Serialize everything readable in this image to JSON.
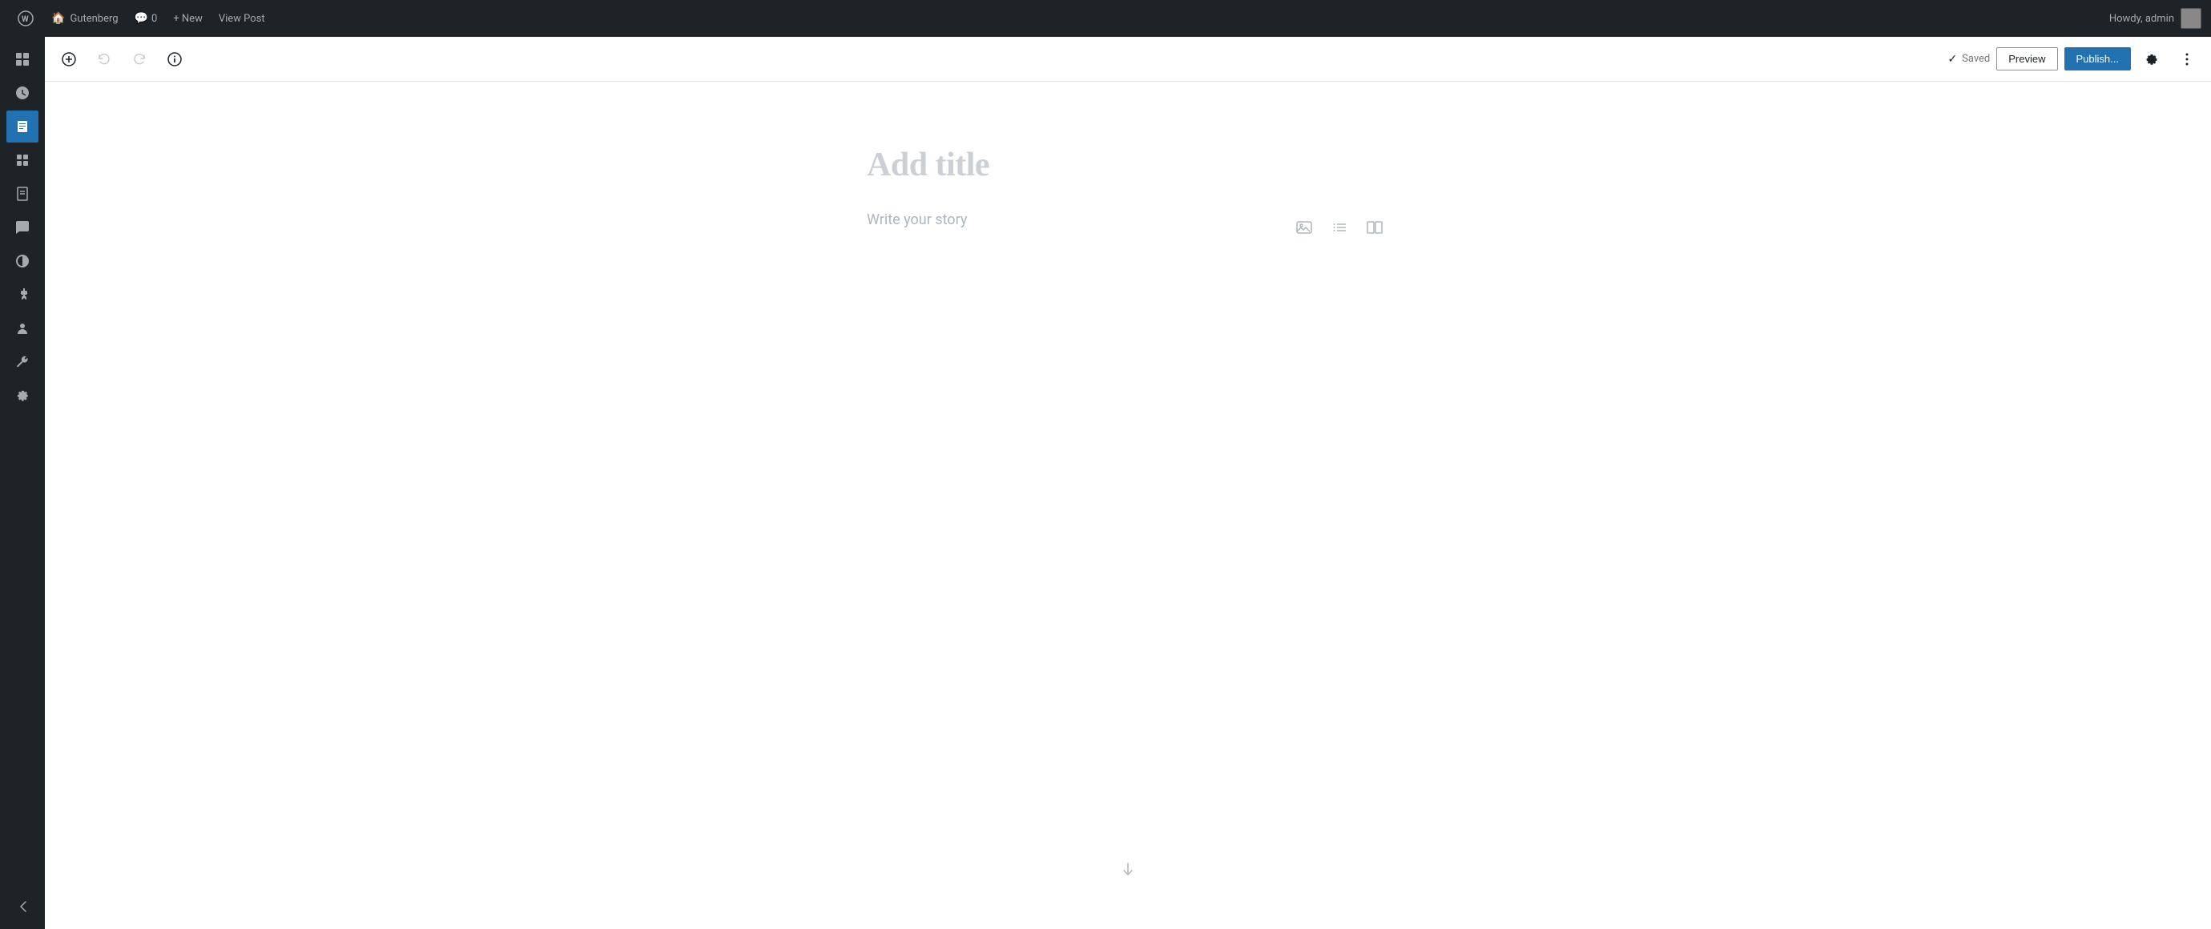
{
  "adminBar": {
    "siteName": "Gutenberg",
    "commentCount": "0",
    "newLabel": "+ New",
    "viewPostLabel": "View Post",
    "howdyLabel": "Howdy, admin"
  },
  "toolbar": {
    "addBlockTitle": "Add block",
    "undoTitle": "Undo",
    "redoTitle": "Redo",
    "detailsTitle": "Details",
    "savedLabel": "Saved",
    "previewLabel": "Preview",
    "publishLabel": "Publish...",
    "settingsTitle": "Settings",
    "moreTitle": "Options"
  },
  "sidebar": {
    "items": [
      {
        "name": "sidebar-dashboard",
        "icon": "⊞",
        "tooltip": "Dashboard"
      },
      {
        "name": "sidebar-lightning",
        "icon": "⚡",
        "tooltip": "Updates"
      },
      {
        "name": "sidebar-pin",
        "icon": "📌",
        "tooltip": "Posts",
        "active": true
      },
      {
        "name": "sidebar-blocks",
        "icon": "⊞",
        "tooltip": "Blocks"
      },
      {
        "name": "sidebar-pages",
        "icon": "▭",
        "tooltip": "Pages"
      },
      {
        "name": "sidebar-comments",
        "icon": "💬",
        "tooltip": "Comments"
      },
      {
        "name": "sidebar-appearance",
        "icon": "🖌",
        "tooltip": "Appearance"
      },
      {
        "name": "sidebar-plugins",
        "icon": "🔌",
        "tooltip": "Plugins"
      },
      {
        "name": "sidebar-users",
        "icon": "👤",
        "tooltip": "Users"
      },
      {
        "name": "sidebar-tools",
        "icon": "🔧",
        "tooltip": "Tools"
      },
      {
        "name": "sidebar-settings",
        "icon": "⚙",
        "tooltip": "Settings"
      },
      {
        "name": "sidebar-collapse",
        "icon": "◀",
        "tooltip": "Collapse menu"
      }
    ]
  },
  "editor": {
    "titlePlaceholder": "Add title",
    "contentPlaceholder": "Write your story",
    "imageIconTitle": "Insert image",
    "listIconTitle": "Insert list",
    "moreIconTitle": "More options"
  },
  "colors": {
    "adminBarBg": "#1d2327",
    "sidebarBg": "#1d2327",
    "activeItemBg": "#2271b1",
    "publishBtnBg": "#2271b1"
  }
}
